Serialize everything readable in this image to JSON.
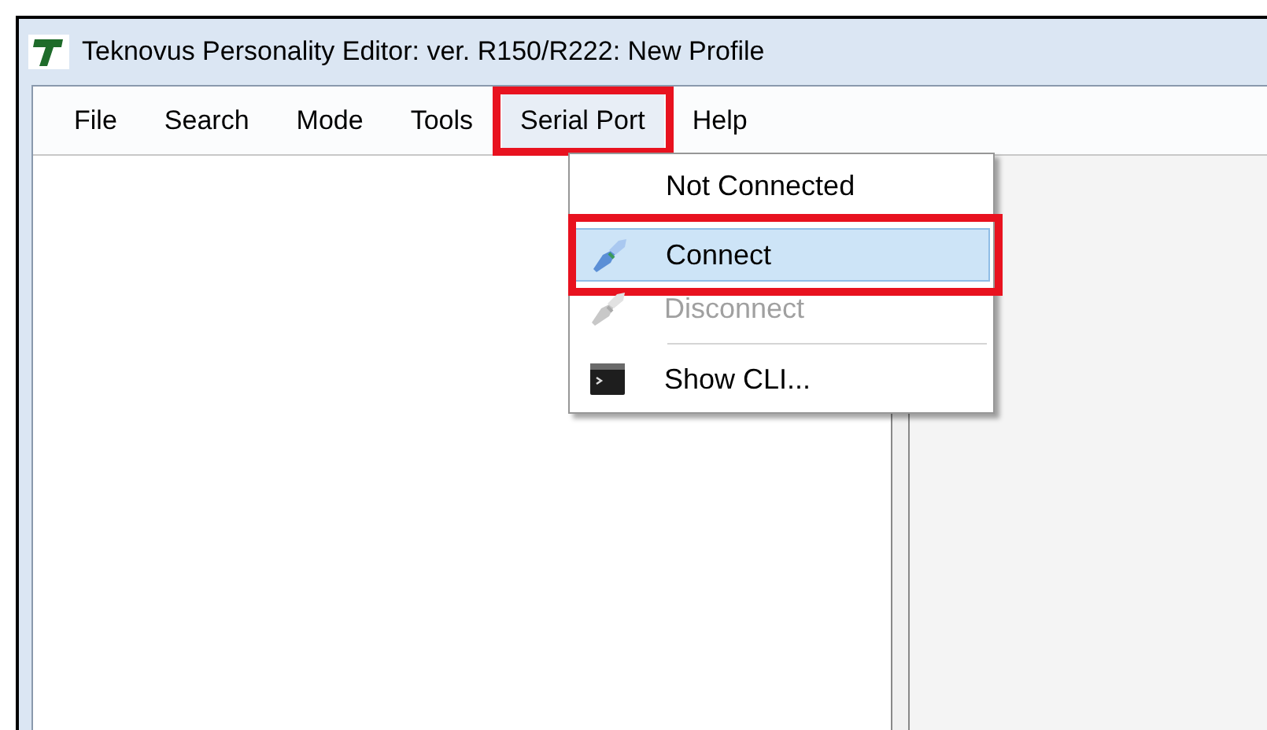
{
  "window": {
    "title": "Teknovus Personality Editor: ver. R150/R222: New Profile"
  },
  "menu_bar": [
    {
      "label": "File",
      "selected": false,
      "annotated": false
    },
    {
      "label": "Search",
      "selected": false,
      "annotated": false
    },
    {
      "label": "Mode",
      "selected": false,
      "annotated": false
    },
    {
      "label": "Tools",
      "selected": false,
      "annotated": false
    },
    {
      "label": "Serial Port",
      "selected": true,
      "annotated": true
    },
    {
      "label": "Help",
      "selected": false,
      "annotated": false
    }
  ],
  "dropdown": [
    {
      "kind": "status",
      "label": "Not Connected"
    },
    {
      "kind": "separator"
    },
    {
      "kind": "plug",
      "label": "Connect",
      "disabled": false,
      "selected": true,
      "annotated": true
    },
    {
      "kind": "plug",
      "label": "Disconnect",
      "disabled": true,
      "selected": false,
      "annotated": false
    },
    {
      "kind": "separator"
    },
    {
      "kind": "terminal",
      "label": "Show CLI...",
      "disabled": false,
      "selected": false,
      "annotated": false
    }
  ]
}
